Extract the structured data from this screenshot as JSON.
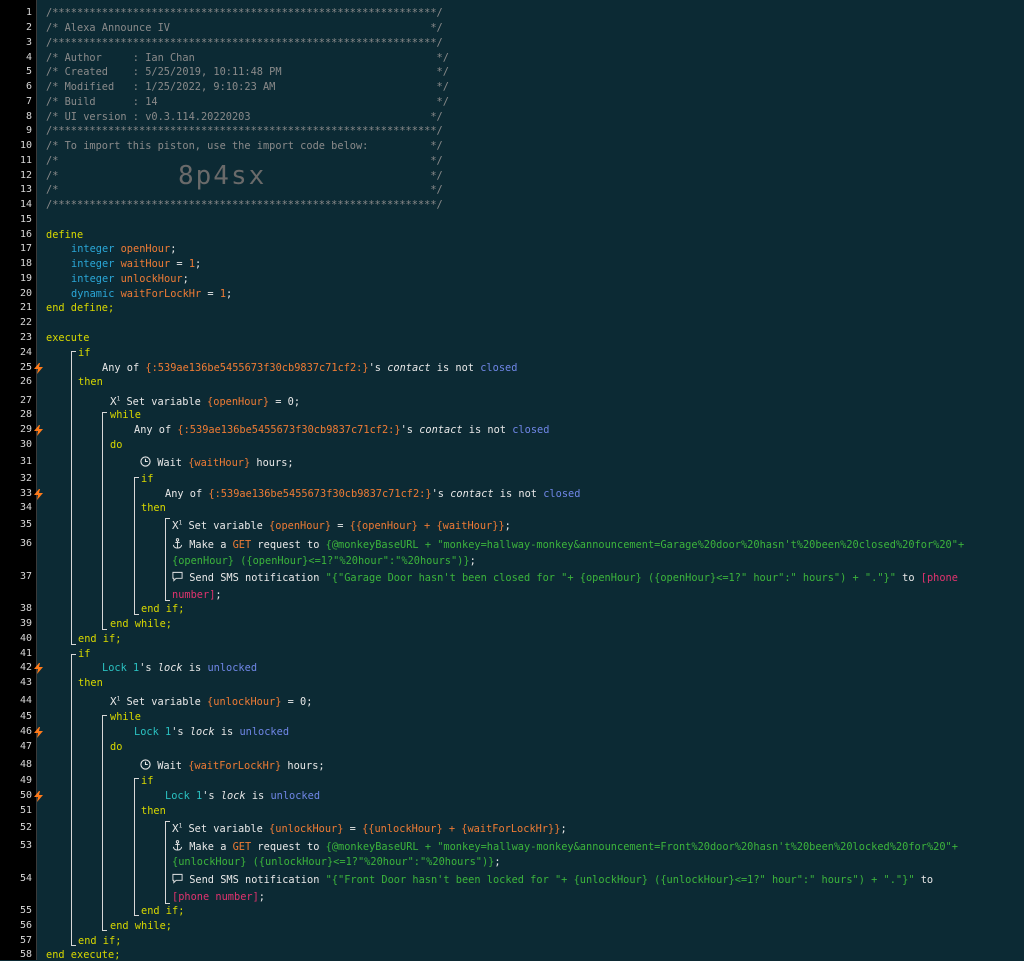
{
  "header": {
    "border": "/**************************************************************/",
    "title": "/* Alexa Announce IV                                          */",
    "author": "/* Author     : Ian Chan                                       */",
    "created": "/* Created    : 5/25/2019, 10:11:48 PM                         */",
    "modified": "/* Modified   : 1/25/2022, 9:10:23 AM                          */",
    "build": "/* Build      : 14                                             */",
    "ui_version": "/* UI version : v0.3.114.20220203                             */",
    "import_note": "/* To import this piston, use the import code below:          */",
    "blank": "/*                                                            */",
    "import_code": "8p4sx"
  },
  "colors": {
    "background": "#0c2a34",
    "gutter": "#000000",
    "keyword": "#d7d700",
    "type": "#2aa6d6",
    "variable": "#ee7b35",
    "value": "#6f86e6",
    "string": "#3cb43c",
    "phone": "#e0336e",
    "bolt": "#ff7a1a"
  },
  "lines": [
    "1",
    "2",
    "3",
    "4",
    "5",
    "6",
    "7",
    "8",
    "9",
    "10",
    "11",
    "12",
    "13",
    "14",
    "15",
    "16",
    "17",
    "18",
    "19",
    "20",
    "21",
    "22",
    "23",
    "24",
    "25",
    "26",
    "27",
    "28",
    "29",
    "30",
    "31",
    "32",
    "33",
    "34",
    "35",
    "36",
    "37",
    "38",
    "39",
    "40",
    "41",
    "42",
    "43",
    "44",
    "45",
    "46",
    "47",
    "48",
    "49",
    "50",
    "51",
    "52",
    "53",
    "54",
    "55",
    "56",
    "57",
    "58"
  ],
  "kw": {
    "define": "define",
    "end_define": "end define;",
    "execute": "execute",
    "end_execute": "end execute;",
    "if": "if",
    "then": "then",
    "end_if": "end if;",
    "while": "while",
    "do": "do",
    "end_while": "end while;",
    "integer": "integer",
    "dynamic": "dynamic"
  },
  "vars": {
    "openHour": "openHour",
    "waitHour": "waitHour",
    "unlockHour": "unlockHour",
    "waitForLockHr": "waitForLockHr",
    "semi": ";",
    "eq1": " = ",
    "one": "1",
    "semicolon": ";"
  },
  "cond": {
    "any_of": "Any of ",
    "device": "{:539ae136be5455673f30cb9837c71cf2:}",
    "s": "'s ",
    "contact": "contact",
    "is_not": " is not ",
    "closed": "closed",
    "lock1": "Lock 1",
    "lock": "lock",
    "is": " is ",
    "unlocked": "unlocked"
  },
  "stmts": {
    "set_var": "Set variable ",
    "open0_var": "{openHour}",
    "eq0": " = 0;",
    "wait": "Wait ",
    "waitHour_var": "{waitHour}",
    "hours": " hours;",
    "open_expr_var": "{openHour}",
    "open_expr_rest": " = ",
    "open_expr_val": "{{openHour} + {waitHour}}",
    "semi": ";",
    "make_a": "Make a ",
    "get": "GET",
    "request_to": " request to ",
    "url1a": "{@monkeyBaseURL + \"monkey=hallway-monkey&announcement=Garage%20door%20hasn't%20been%20closed%20for%20\"+",
    "url1b": "{openHour} ({openHour}<=1?\"%20hour\":\"%20hours\")}",
    "send_sms": "Send SMS notification ",
    "sms1a": "\"{\"Garage Door hasn't been closed for \"+ {openHour} ({openHour}<=1?\" hour\":\" hours\") + \".\"}\"",
    "to": " to ",
    "phone1a": "[phone",
    "phone1b": "number]",
    "unlock0_var": "{unlockHour}",
    "waitLock_var": "{waitForLockHr}",
    "unlock_expr_var": "{unlockHour}",
    "unlock_expr_val": "{{unlockHour} + {waitForLockHr}}",
    "url2a": "{@monkeyBaseURL + \"monkey=hallway-monkey&announcement=Front%20door%20hasn't%20been%20locked%20for%20\"+",
    "url2b": "{unlockHour} ({unlockHour}<=1?\"%20hour\":\"%20hours\")}",
    "sms2a": "\"{\"Front Door hasn't been locked for \"+ {unlockHour} ({unlockHour}<=1?\" hour\":\" hours\") + \".\"}\"",
    "to2": " to",
    "phone2": "[phone number]"
  }
}
